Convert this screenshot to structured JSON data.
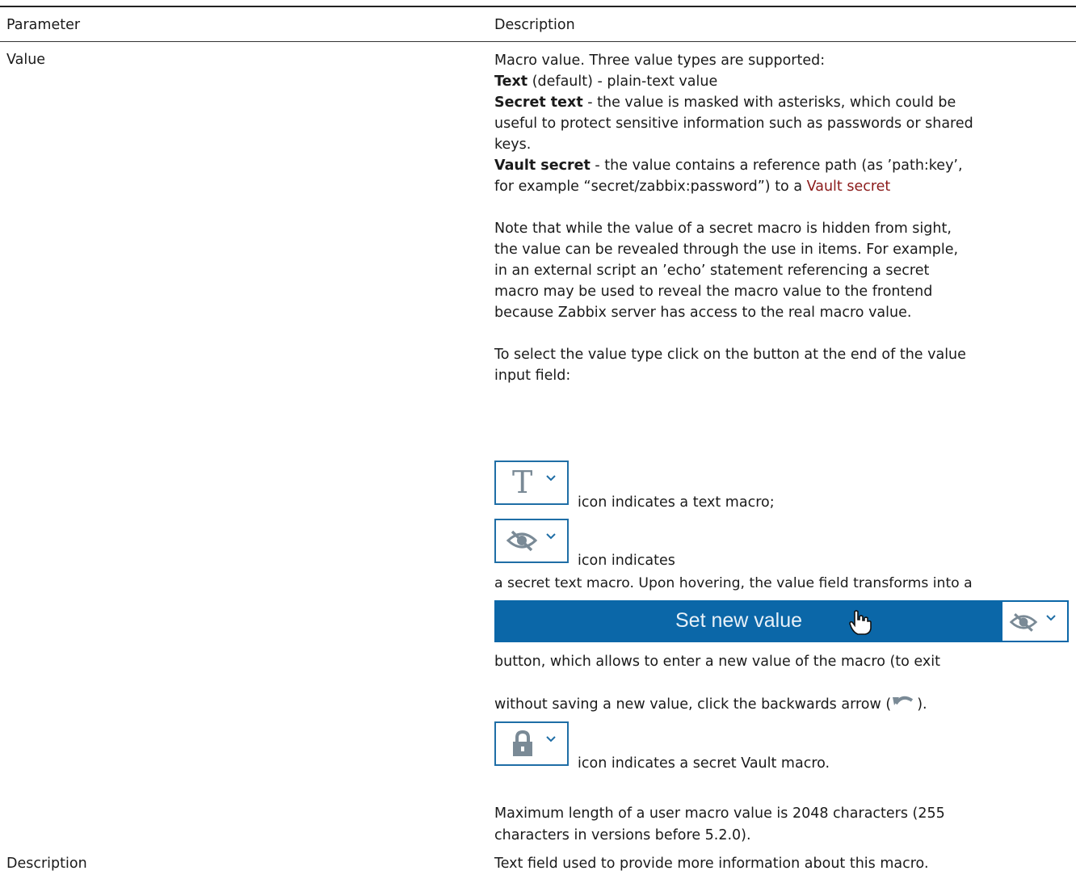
{
  "table": {
    "col_param": "Parameter",
    "col_desc": "Description"
  },
  "rows": [
    {
      "param": "Value"
    },
    {
      "param": "Description",
      "desc": "Text field used to provide more information about this macro."
    }
  ],
  "value_desc": {
    "intro": "Macro value.  Three value types are supported:",
    "text_bold": "Text",
    "text_rest": " (default) - plain-text value",
    "secret_bold": "Secret text",
    "secret_line1": " - the value is masked with asterisks, which could be",
    "secret_line2": "useful to protect sensitive information such as passwords or shared",
    "secret_line3": "keys.",
    "vault_bold": "Vault secret",
    "vault_line1": " - the value contains a reference path (as ’path:key’,",
    "vault_line2": "for example “secret/zabbix:password”) to a ",
    "vault_link": "Vault secret",
    "note_l1": "Note that while the value of a secret macro is hidden from sight,",
    "note_l2": "the value can be revealed through the use in items. For example,",
    "note_l3": "in an external script an ’echo’ statement referencing a secret",
    "note_l4": "macro may be used to reveal the macro value to the frontend",
    "note_l5": "because Zabbix server has access to the real macro value.",
    "select_l1": "To select the value type click on the button at the end of the value",
    "select_l2": "input field:",
    "icon_text_caption": "icon indicates a text macro;",
    "icon_secret_caption": "icon indicates",
    "secret_text_line": "a secret text macro.  Upon hovering, the value field transforms into a",
    "set_new_value": "Set new value",
    "button_l1": "button, which allows to enter a new value of the macro (to exit",
    "button_l2a": "without saving a new value, click the backwards arrow (",
    "button_l2b": ").",
    "icon_vault_caption": "icon indicates a secret Vault macro.",
    "max_l1": "Maximum length of a user macro value is 2048 characters (255",
    "max_l2": "characters in versions before 5.2.0)."
  },
  "icons": {
    "text_icon_glyph": "T",
    "accent_color": "#1f6ea6",
    "bar_color": "#0b67a8",
    "link_color": "#8b1a1a"
  }
}
